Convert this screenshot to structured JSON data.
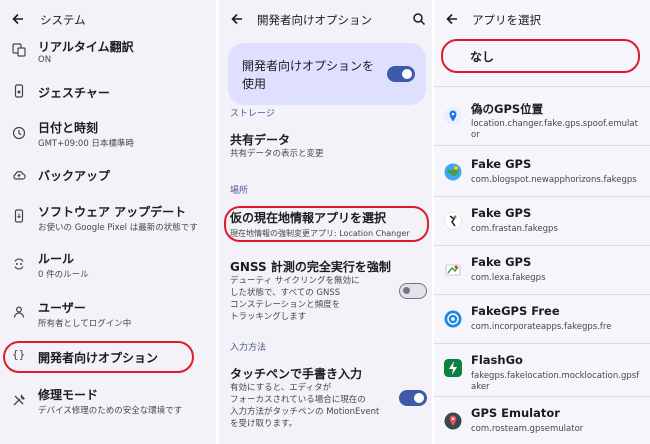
{
  "panel1": {
    "title": "システム",
    "items": [
      {
        "title": "リアルタイム翻訳",
        "sub": "ON",
        "icon": "translate-icon"
      },
      {
        "title": "ジェスチャー",
        "sub": "",
        "icon": "phone-gesture-icon"
      },
      {
        "title": "日付と時刻",
        "sub": "GMT+09:00 日本標準時",
        "icon": "clock-icon"
      },
      {
        "title": "バックアップ",
        "sub": "",
        "icon": "cloud-backup-icon"
      },
      {
        "title": "ソフトウェア アップデート",
        "sub": "お使いの Google Pixel は最新の状態です",
        "icon": "system-update-icon"
      },
      {
        "title": "ルール",
        "sub": "0 件のルール",
        "icon": "rules-icon"
      },
      {
        "title": "ユーザー",
        "sub": "所有者としてログイン中",
        "icon": "person-icon"
      },
      {
        "title": "開発者向けオプション",
        "sub": "",
        "icon": "code-braces-icon"
      },
      {
        "title": "修理モード",
        "sub": "デバイス修理のための安全な環境です",
        "icon": "repair-tools-icon"
      }
    ]
  },
  "panel2": {
    "title": "開発者向けオプション",
    "dev_toggle_label": "開発者向けオプションを使用",
    "storage_header": "ストレージ",
    "shared_data_title": "共有データ",
    "shared_data_sub": "共有データの表示と変更",
    "location_header": "場所",
    "mock_app_title": "仮の現在地情報アプリを選択",
    "mock_app_sub": "現在地情報の強制変更アプリ: Location Changer",
    "gnss_title": "GNSS 計測の完全実行を強制",
    "gnss_sub": [
      "デューティ サイクリングを無効に",
      "した状態で、すべての GNSS",
      "コンステレーションと頻度を",
      "トラッキングします"
    ],
    "input_header": "入力方法",
    "stylus_title": "タッチペンで手書き入力",
    "stylus_sub": [
      "有効にすると、エディタが",
      "フォーカスされている場合に現在の",
      "入力方法がタッチペンの MotionEvent",
      "を受け取ります。"
    ]
  },
  "panel3": {
    "title": "アプリを選択",
    "none_label": "なし",
    "apps": [
      {
        "name": "偽のGPS位置",
        "pkg": [
          "location.changer.fake.gps.spoof.emulat",
          "or"
        ],
        "color": "#1a73e8"
      },
      {
        "name": "Fake GPS",
        "pkg": [
          "com.blogspot.newapphorizons.fakegps"
        ],
        "color": "#2e7d32"
      },
      {
        "name": "Fake GPS",
        "pkg": [
          "com.frastan.fakegps"
        ],
        "color": "#ffffff"
      },
      {
        "name": "Fake GPS",
        "pkg": [
          "com.lexa.fakegps"
        ],
        "color": "#ffffff"
      },
      {
        "name": "FakeGPS Free",
        "pkg": [
          "com.incorporateapps.fakegps.fre"
        ],
        "color": "#1e88e5"
      },
      {
        "name": "FlashGo",
        "pkg": [
          "fakegps.fakelocation.mocklocation.gpsf",
          "aker"
        ],
        "color": "#0b8043"
      },
      {
        "name": "GPS Emulator",
        "pkg": [
          "com.rosteam.gpsemulator"
        ],
        "color": "#37474f"
      }
    ]
  }
}
